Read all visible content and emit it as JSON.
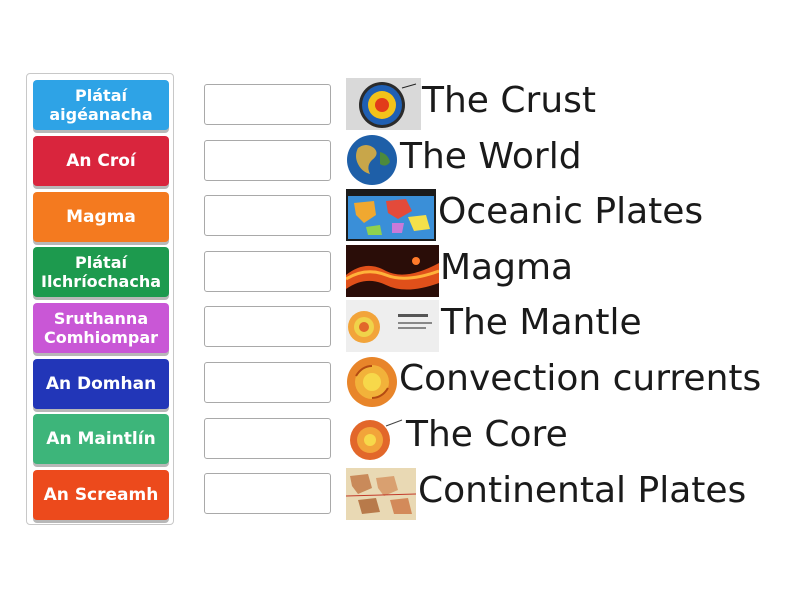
{
  "tiles": [
    {
      "lines": [
        "Plátaí",
        "aigéanacha"
      ],
      "color": "#2ea3e6"
    },
    {
      "lines": [
        "An Croí"
      ],
      "color": "#d9253d"
    },
    {
      "lines": [
        "Magma"
      ],
      "color": "#f47a1f"
    },
    {
      "lines": [
        "Plátaí",
        "Ilchríochacha"
      ],
      "color": "#1d9a4e"
    },
    {
      "lines": [
        "Sruthanna",
        "Comhiompar"
      ],
      "color": "#c957d6"
    },
    {
      "lines": [
        "An Domhan"
      ],
      "color": "#2236b8"
    },
    {
      "lines": [
        "An Maintlín"
      ],
      "color": "#3db57a"
    },
    {
      "lines": [
        "An Screamh"
      ],
      "color": "#ec4a1c"
    }
  ],
  "targets": [
    {
      "label": "The Crust",
      "image": "crust-diagram-icon"
    },
    {
      "label": "The World",
      "image": "globe-icon"
    },
    {
      "label": "Oceanic Plates",
      "image": "plates-map-icon"
    },
    {
      "label": "Magma",
      "image": "lava-icon"
    },
    {
      "label": "The Mantle",
      "image": "mantle-diagram-icon"
    },
    {
      "label": "Convection currents",
      "image": "convection-icon"
    },
    {
      "label": "The Core",
      "image": "core-diagram-icon"
    },
    {
      "label": "Continental Plates",
      "image": "continents-map-icon"
    }
  ]
}
